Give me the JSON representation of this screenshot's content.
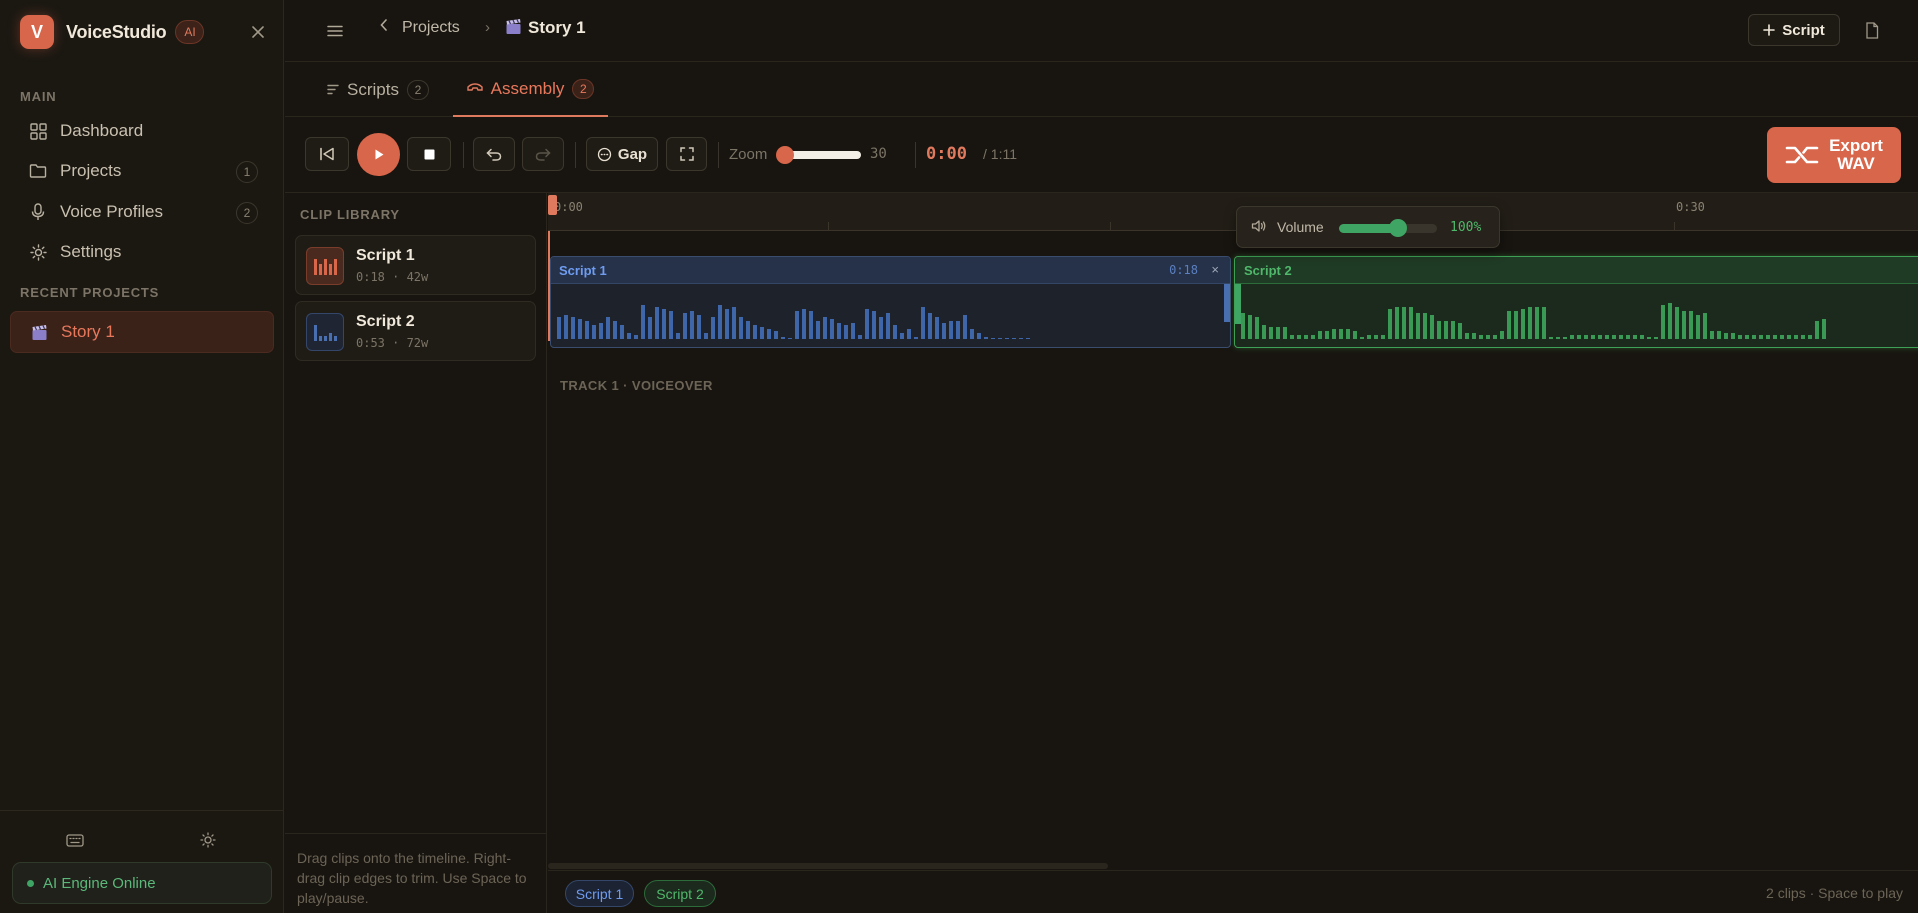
{
  "brand": {
    "logo_letter": "V",
    "name": "VoiceStudio",
    "badge": "AI"
  },
  "sidebar": {
    "main_label": "MAIN",
    "items": [
      {
        "label": "Dashboard",
        "icon": "grid-icon"
      },
      {
        "label": "Projects",
        "icon": "folder-icon",
        "count": "1"
      },
      {
        "label": "Voice Profiles",
        "icon": "microphone-icon",
        "count": "2"
      },
      {
        "label": "Settings",
        "icon": "gear-icon"
      }
    ],
    "recent_label": "RECENT PROJECTS",
    "recent": [
      {
        "label": "Story 1",
        "icon": "clapperboard-icon"
      }
    ],
    "engine_status": "AI Engine Online"
  },
  "header": {
    "breadcrumb_projects": "Projects",
    "breadcrumb_sep": "›",
    "breadcrumb_current": "Story 1",
    "script_button": "Script"
  },
  "tabs": [
    {
      "label": "Scripts",
      "count": "2",
      "active": false
    },
    {
      "label": "Assembly",
      "count": "2",
      "active": true
    }
  ],
  "toolbar": {
    "gap_label": "Gap",
    "zoom_label": "Zoom",
    "zoom_value": "30",
    "time_current": "0:00",
    "time_total": "/ 1:11",
    "export_line1": "Export",
    "export_line2": "WAV"
  },
  "library": {
    "title": "CLIP LIBRARY",
    "clips": [
      {
        "name": "Script 1",
        "meta": "0:18 · 42w"
      },
      {
        "name": "Script 2",
        "meta": "0:53 · 72w"
      }
    ],
    "help": "Drag clips onto the timeline. Right-drag clip edges to trim. Use Space to play/pause."
  },
  "timeline": {
    "ruler_labels": [
      "0:00",
      "0:30"
    ],
    "clip1": {
      "name": "Script 1",
      "duration": "0:18",
      "close": "×"
    },
    "clip2": {
      "name": "Script 2"
    },
    "volume": {
      "label": "Volume",
      "value": "100%",
      "level": 0.6
    },
    "track_label": "TRACK 1 · VOICEOVER"
  },
  "bottombar": {
    "chips": [
      "Script 1",
      "Script 2"
    ],
    "status": "2 clips · Space to play"
  },
  "colors": {
    "accent": "#d8664a",
    "clip1": "#4a6fb0",
    "clip2": "#3fa564"
  }
}
